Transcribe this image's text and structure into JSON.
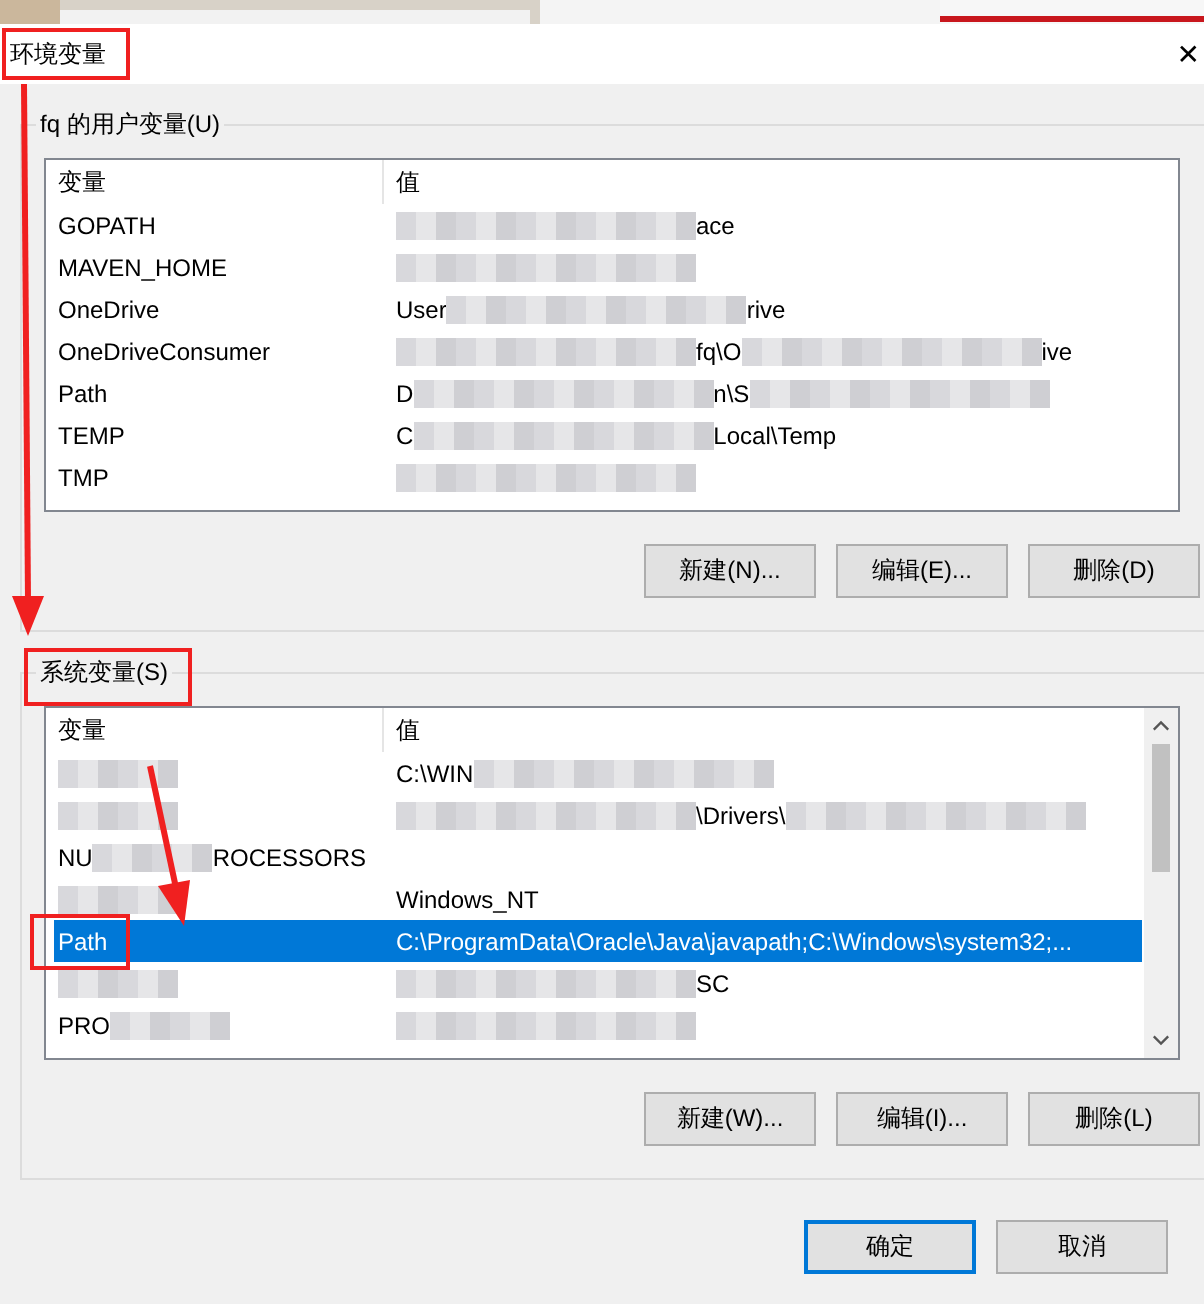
{
  "window": {
    "title": "环境变量",
    "close": "✕"
  },
  "user_vars": {
    "label": "fq 的用户变量(U)",
    "columns": [
      "变量",
      "值"
    ],
    "rows": [
      {
        "selected": false,
        "name": [
          {
            "kind": "text",
            "text": "GOPATH"
          }
        ],
        "value": [
          {
            "kind": "blur"
          },
          {
            "kind": "text",
            "text": "ace"
          }
        ]
      },
      {
        "selected": false,
        "name": [
          {
            "kind": "text",
            "text": "MAVEN_HOME"
          }
        ],
        "value": [
          {
            "kind": "blur"
          }
        ]
      },
      {
        "selected": false,
        "name": [
          {
            "kind": "text",
            "text": "OneDrive"
          }
        ],
        "value": [
          {
            "kind": "text",
            "text": "User"
          },
          {
            "kind": "blur"
          },
          {
            "kind": "text",
            "text": "rive"
          }
        ]
      },
      {
        "selected": false,
        "name": [
          {
            "kind": "text",
            "text": "OneDriveConsumer"
          }
        ],
        "value": [
          {
            "kind": "blur"
          },
          {
            "kind": "text",
            "text": "fq\\O"
          },
          {
            "kind": "blur"
          },
          {
            "kind": "text",
            "text": "ive"
          }
        ]
      },
      {
        "selected": false,
        "name": [
          {
            "kind": "text",
            "text": "Path"
          }
        ],
        "value": [
          {
            "kind": "text",
            "text": "D"
          },
          {
            "kind": "blur"
          },
          {
            "kind": "text",
            "text": "n\\S"
          },
          {
            "kind": "blur"
          }
        ]
      },
      {
        "selected": false,
        "name": [
          {
            "kind": "text",
            "text": "TEMP"
          }
        ],
        "value": [
          {
            "kind": "text",
            "text": "C"
          },
          {
            "kind": "blur"
          },
          {
            "kind": "text",
            "text": "Local\\Temp"
          }
        ]
      },
      {
        "selected": false,
        "name": [
          {
            "kind": "text",
            "text": "TMP"
          }
        ],
        "value": [
          {
            "kind": "blur"
          }
        ]
      }
    ],
    "buttons": [
      "新建(N)...",
      "编辑(E)...",
      "删除(D)"
    ]
  },
  "system_vars": {
    "label": "系统变量(S)",
    "columns": [
      "变量",
      "值"
    ],
    "rows": [
      {
        "selected": false,
        "name": [
          {
            "kind": "blur"
          }
        ],
        "value": [
          {
            "kind": "text",
            "text": "C:\\WIN"
          },
          {
            "kind": "blur"
          }
        ]
      },
      {
        "selected": false,
        "name": [
          {
            "kind": "blur"
          }
        ],
        "value": [
          {
            "kind": "blur"
          },
          {
            "kind": "text",
            "text": "\\Drivers\\"
          },
          {
            "kind": "blur"
          }
        ]
      },
      {
        "selected": false,
        "name": [
          {
            "kind": "text",
            "text": "NU"
          },
          {
            "kind": "blur"
          },
          {
            "kind": "text",
            "text": "ROCESSORS"
          }
        ],
        "value": []
      },
      {
        "selected": false,
        "name": [
          {
            "kind": "blur"
          }
        ],
        "value": [
          {
            "kind": "text",
            "text": "Windows_NT"
          }
        ]
      },
      {
        "selected": true,
        "name": [
          {
            "kind": "text",
            "text": "Path"
          }
        ],
        "value": [
          {
            "kind": "text",
            "text": "C:\\ProgramData\\Oracle\\Java\\javapath;C:\\Windows\\system32;..."
          }
        ]
      },
      {
        "selected": false,
        "name": [
          {
            "kind": "blur"
          }
        ],
        "value": [
          {
            "kind": "blur"
          },
          {
            "kind": "text",
            "text": "SC"
          }
        ]
      },
      {
        "selected": false,
        "name": [
          {
            "kind": "text",
            "text": "PRO"
          },
          {
            "kind": "blur"
          }
        ],
        "value": [
          {
            "kind": "blur"
          }
        ]
      }
    ],
    "buttons": [
      "新建(W)...",
      "编辑(I)...",
      "删除(L)"
    ]
  },
  "dialog_buttons": [
    "确定",
    "取消"
  ]
}
